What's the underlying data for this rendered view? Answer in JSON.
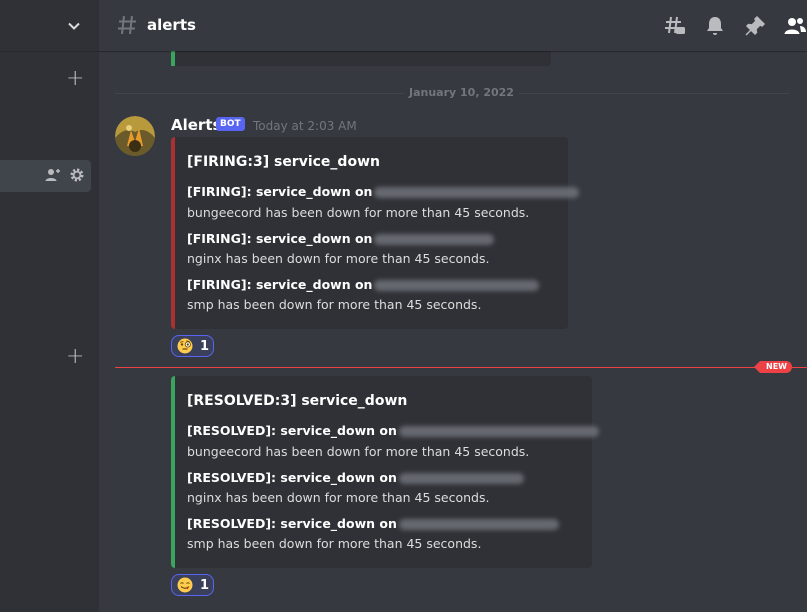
{
  "channel": {
    "name": "alerts"
  },
  "date_divider": "January 10, 2022",
  "new_marker": "NEW",
  "colors": {
    "firing": "#a9312f",
    "resolved": "#3ba55d",
    "accent": "#5865f2",
    "new": "#ed4245"
  },
  "message": {
    "author": "Alerts",
    "bot_tag": "BOT",
    "timestamp": "Today at 2:03 AM",
    "embeds": [
      {
        "status": "firing",
        "title": "[FIRING:3] service_down",
        "alerts": [
          {
            "head": "[FIRING]: service_down on",
            "desc": "bungeecord has been down for more than 45 seconds."
          },
          {
            "head": "[FIRING]: service_down on",
            "desc": "nginx has been down for more than 45 seconds."
          },
          {
            "head": "[FIRING]: service_down on",
            "desc": "smp has been down for more than 45 seconds."
          }
        ],
        "reaction": {
          "emoji": "face-with-monocle",
          "count": "1"
        }
      },
      {
        "status": "resolved",
        "title": "[RESOLVED:3] service_down",
        "alerts": [
          {
            "head": "[RESOLVED]: service_down on",
            "desc": "bungeecord has been down for more than 45 seconds."
          },
          {
            "head": "[RESOLVED]: service_down on",
            "desc": "nginx has been down for more than 45 seconds."
          },
          {
            "head": "[RESOLVED]: service_down on",
            "desc": "smp has been down for more than 45 seconds."
          }
        ],
        "reaction": {
          "emoji": "face-savoring-food",
          "count": "1"
        }
      }
    ]
  }
}
